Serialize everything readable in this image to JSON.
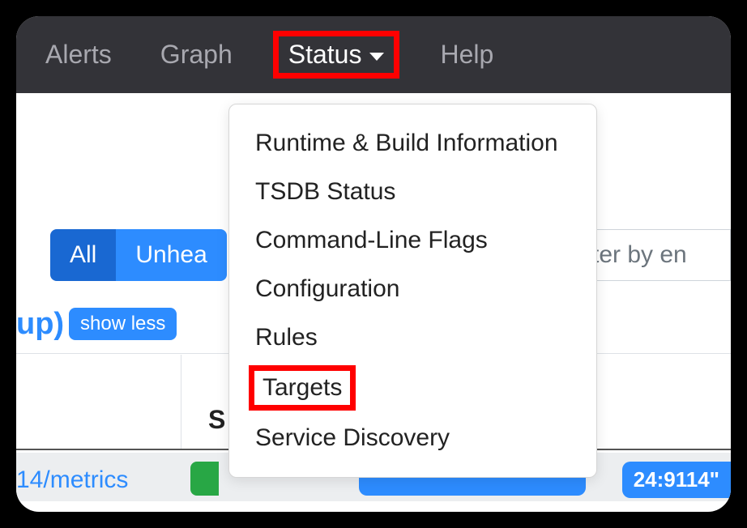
{
  "nav": {
    "alerts": "Alerts",
    "graph": "Graph",
    "status": "Status",
    "help": "Help"
  },
  "dropdown": {
    "runtime": "Runtime & Build Information",
    "tsdb": "TSDB Status",
    "cmdflags": "Command-Line Flags",
    "config": "Configuration",
    "rules": "Rules",
    "targets": "Targets",
    "service_discovery": "Service Discovery"
  },
  "filters": {
    "all": "All",
    "unhealthy": "Unhea",
    "placeholder": "ter by en"
  },
  "status": {
    "up": "up)",
    "show_less": "show less"
  },
  "table": {
    "col_s": "S",
    "endpoint": "14/metrics",
    "badge": "24:9114\""
  }
}
